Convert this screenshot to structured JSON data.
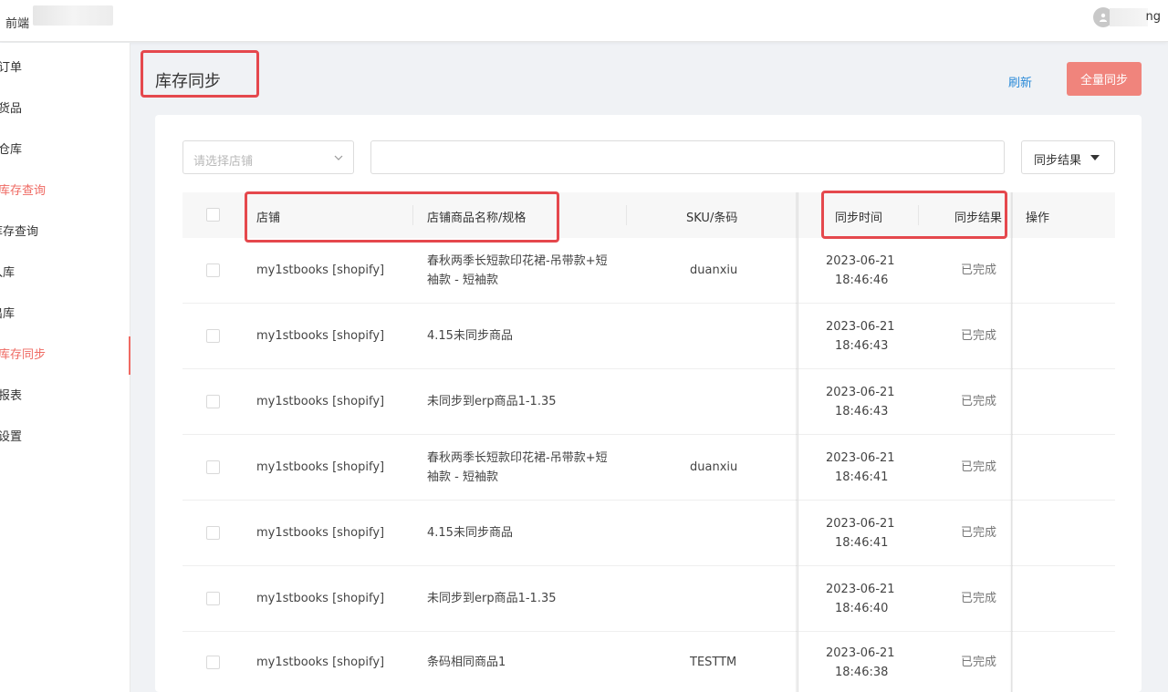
{
  "header": {
    "brand": "前端",
    "user_suffix": "ng"
  },
  "sidebar": {
    "items": [
      {
        "label": "订单"
      },
      {
        "label": "货品"
      },
      {
        "label": "仓库"
      },
      {
        "label": "库存查询"
      },
      {
        "label": "库存查询"
      },
      {
        "label": "入库"
      },
      {
        "label": "出库"
      },
      {
        "label": "库存同步"
      },
      {
        "label": "报表"
      },
      {
        "label": "设置"
      }
    ]
  },
  "page": {
    "title": "库存同步",
    "refresh_label": "刷新",
    "sync_all_label": "全量同步"
  },
  "filters": {
    "store_placeholder": "请选择店铺",
    "search_value": "",
    "result_label": "同步结果"
  },
  "table": {
    "columns": {
      "store": "店铺",
      "product": "店铺商品名称/规格",
      "sku": "SKU/条码",
      "sync_time": "同步时间",
      "sync_result": "同步结果",
      "actions": "操作"
    },
    "rows": [
      {
        "store": "my1stbooks [shopify]",
        "product": "春秋两季长短款印花裙-吊带款+短袖款 - 短袖款",
        "sku": "duanxiu",
        "date": "2023-06-21",
        "time": "18:46:46",
        "result": "已完成"
      },
      {
        "store": "my1stbooks [shopify]",
        "product": "4.15未同步商品",
        "sku": "",
        "date": "2023-06-21",
        "time": "18:46:43",
        "result": "已完成"
      },
      {
        "store": "my1stbooks [shopify]",
        "product": "未同步到erp商品1-1.35",
        "sku": "",
        "date": "2023-06-21",
        "time": "18:46:43",
        "result": "已完成"
      },
      {
        "store": "my1stbooks [shopify]",
        "product": "春秋两季长短款印花裙-吊带款+短袖款 - 短袖款",
        "sku": "duanxiu",
        "date": "2023-06-21",
        "time": "18:46:41",
        "result": "已完成"
      },
      {
        "store": "my1stbooks [shopify]",
        "product": "4.15未同步商品",
        "sku": "",
        "date": "2023-06-21",
        "time": "18:46:41",
        "result": "已完成"
      },
      {
        "store": "my1stbooks [shopify]",
        "product": "未同步到erp商品1-1.35",
        "sku": "",
        "date": "2023-06-21",
        "time": "18:46:40",
        "result": "已完成"
      },
      {
        "store": "my1stbooks [shopify]",
        "product": "条码相同商品1",
        "sku": "TESTTM",
        "date": "2023-06-21",
        "time": "18:46:38",
        "result": "已完成"
      }
    ]
  },
  "colors": {
    "accent": "#ef6a63",
    "highlight_box": "#e5484d",
    "link": "#2a8ad8",
    "primary_button": "#f0847c"
  }
}
